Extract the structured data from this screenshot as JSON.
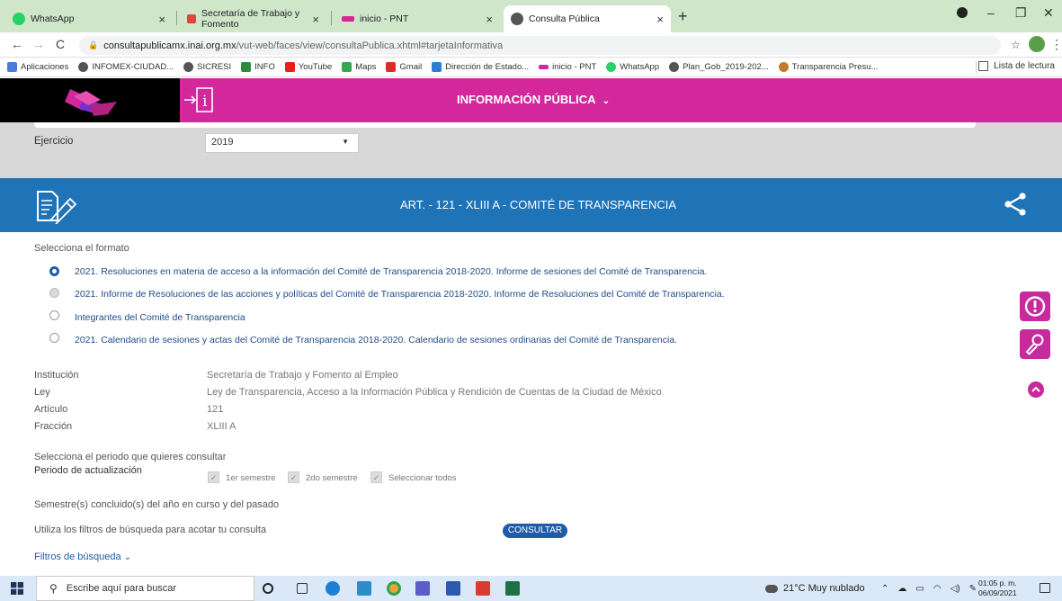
{
  "browser": {
    "tabs": [
      {
        "label": "WhatsApp",
        "color": "#25d366"
      },
      {
        "label": "Secretaría de Trabajo y Fomento",
        "color": "#e0443d"
      },
      {
        "label": "inicio - PNT",
        "color": "#d4279b"
      },
      {
        "label": "Consulta Pública",
        "color": "#555555"
      }
    ],
    "new_tab": "+",
    "url_host": "consultapublicamx.inai.org.mx",
    "url_path": "/vut-web/faces/view/consultaPublica.xhtml#tarjetaInformativa",
    "bookmarks": [
      {
        "label": "Aplicaciones",
        "color": "#4a7bd6"
      },
      {
        "label": "INFOMEX-CIUDAD...",
        "color": "#555555"
      },
      {
        "label": "SICRESI",
        "color": "#555555"
      },
      {
        "label": "INFO",
        "color": "#2b8a3e"
      },
      {
        "label": "YouTube",
        "color": "#e62117"
      },
      {
        "label": "Maps",
        "color": "#34a853"
      },
      {
        "label": "Gmail",
        "color": "#d93025"
      },
      {
        "label": "Dirección de Estado...",
        "color": "#2e7dd1"
      },
      {
        "label": "inicio - PNT",
        "color": "#d4279b"
      },
      {
        "label": "WhatsApp",
        "color": "#25d366"
      },
      {
        "label": "Plan_Gob_2019-202...",
        "color": "#555555"
      },
      {
        "label": "Transparencia Presu...",
        "color": "#c47a2c"
      }
    ],
    "reading_list": "Lista de lectura"
  },
  "header": {
    "title": "INFORMACIÓN PÚBLICA",
    "accent": "#d4279b"
  },
  "filters": {
    "ejercicio_label": "Ejercicio",
    "ejercicio_value": "2019"
  },
  "article": {
    "title": "ART. - 121 - XLIII A - COMITÉ DE TRANSPARENCIA",
    "band_color": "#1f73b7"
  },
  "formats": {
    "label": "Selecciona el formato",
    "options": [
      {
        "label": "2021. Resoluciones en materia de acceso a la información del Comité de Transparencia 2018-2020. Informe de sesiones del Comité de Transparencia.",
        "selected": true
      },
      {
        "label": "2021. Informe de Resoluciones de las acciones y políticas del Comité de Transparencia 2018-2020. Informe de Resoluciones del Comité de Transparencia.",
        "selected": false
      },
      {
        "label": "Integrantes del Comité de Transparencia",
        "selected": false
      },
      {
        "label": "2021. Calendario de sesiones y actas del Comité de Transparencia 2018-2020. Calendario de sesiones ordinarias del Comité de Transparencia.",
        "selected": false
      }
    ]
  },
  "details": [
    {
      "key": "Institución",
      "value": "Secretaría de Trabajo y Fomento al Empleo"
    },
    {
      "key": "Ley",
      "value": "Ley de Transparencia, Acceso a la Información Pública y Rendición de Cuentas de la Ciudad de México"
    },
    {
      "key": "Artículo",
      "value": "121"
    },
    {
      "key": "Fracción",
      "value": "XLIII A"
    }
  ],
  "period": {
    "prompt": "Selecciona el periodo que quieres consultar",
    "label": "Periodo de actualización",
    "options": [
      "1er semestre",
      "2do semestre",
      "Seleccionar todos"
    ],
    "note": "Semestre(s) concluido(s) del año en curso y del pasado",
    "filter_hint": "Utiliza los filtros de búsqueda para acotar tu consulta",
    "consult_button": "CONSULTAR",
    "filters_link": "Filtros de búsqueda"
  },
  "taskbar": {
    "search_placeholder": "Escribe aquí para buscar",
    "weather": "21°C  Muy nublado",
    "time": "01:05 p. m.",
    "date": "06/09/2021"
  }
}
